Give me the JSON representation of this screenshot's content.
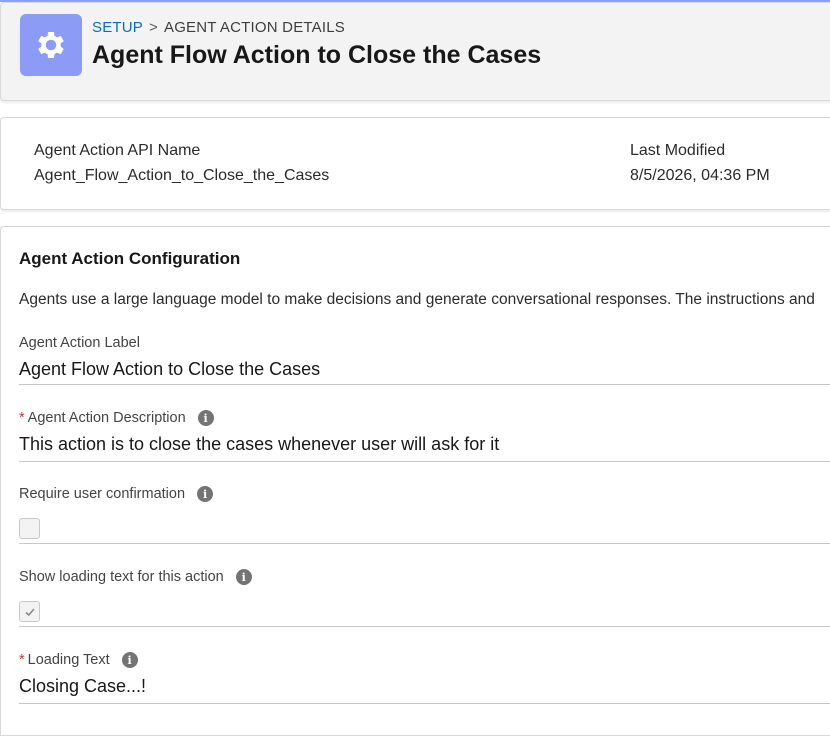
{
  "header": {
    "breadcrumb": {
      "root": "SETUP",
      "separator": ">",
      "current": "AGENT ACTION DETAILS"
    },
    "title": "Agent Flow Action to Close the Cases",
    "icon": "gear-icon"
  },
  "info": {
    "api_name_label": "Agent Action API Name",
    "api_name_value": "Agent_Flow_Action_to_Close_the_Cases",
    "last_modified_label": "Last Modified",
    "last_modified_value": "8/5/2026, 04:36 PM"
  },
  "config": {
    "title": "Agent Action Configuration",
    "description": "Agents use a large language model to make decisions and generate conversational responses. The instructions and",
    "fields": {
      "label": {
        "label": "Agent Action Label",
        "value": "Agent Flow Action to Close the Cases"
      },
      "description": {
        "label": "Agent Action Description",
        "required": "*",
        "value": "This action is to close the cases whenever user will ask for it"
      },
      "confirmation": {
        "label": "Require user confirmation",
        "checked": false
      },
      "loading_toggle": {
        "label": "Show loading text for this action",
        "checked": true
      },
      "loading_text": {
        "label": "Loading Text",
        "required": "*",
        "value": "Closing Case...!"
      }
    },
    "info_glyph": "i"
  },
  "colors": {
    "accent": "#8b9bf6",
    "link": "#0b6bcb",
    "required": "#c23934"
  }
}
